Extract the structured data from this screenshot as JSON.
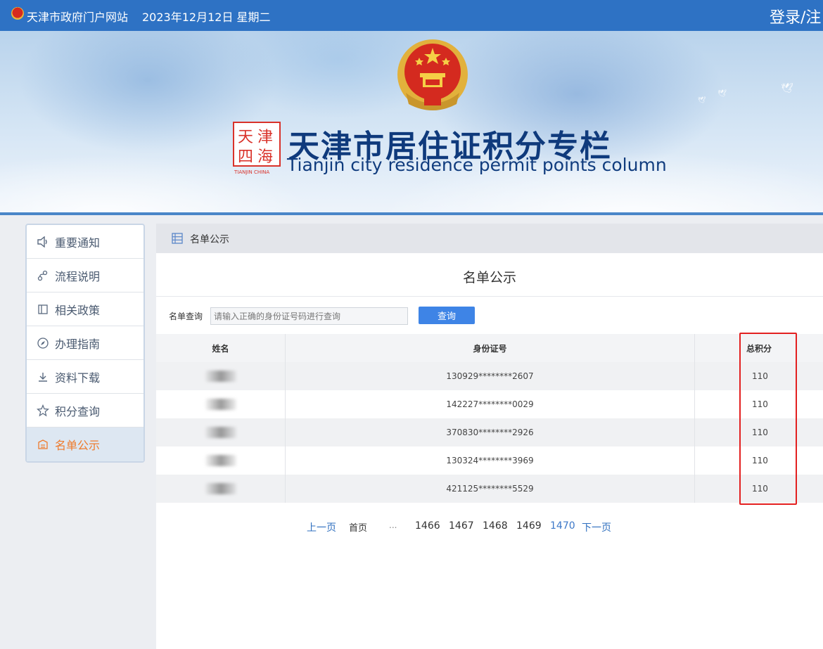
{
  "topbar": {
    "site_name": "天津市政府门户网站",
    "date_text": "2023年12月12日 星期二",
    "login_label": "登录/注"
  },
  "banner": {
    "title_cn": "天津市居住证积分专栏",
    "title_en": "Tianjin city residence permit points column"
  },
  "sidebar": {
    "items": [
      {
        "label": "重要通知",
        "icon": "speaker-icon"
      },
      {
        "label": "流程说明",
        "icon": "flow-icon"
      },
      {
        "label": "相关政策",
        "icon": "book-icon"
      },
      {
        "label": "办理指南",
        "icon": "compass-icon"
      },
      {
        "label": "资料下载",
        "icon": "download-icon"
      },
      {
        "label": "积分查询",
        "icon": "star-icon"
      },
      {
        "label": "名单公示",
        "icon": "calendar-icon"
      }
    ],
    "active_index": 6
  },
  "main": {
    "breadcrumb": "名单公示",
    "title": "名单公示",
    "search": {
      "label": "名单查询",
      "placeholder": "请输入正确的身份证号码进行查询",
      "button_label": "查询"
    },
    "table": {
      "headers": [
        "姓名",
        "身份证号",
        "总积分"
      ],
      "rows": [
        {
          "id": "130929********2607",
          "score": "110"
        },
        {
          "id": "142227********0029",
          "score": "110"
        },
        {
          "id": "370830********2926",
          "score": "110"
        },
        {
          "id": "130324********3969",
          "score": "110"
        },
        {
          "id": "421125********5529",
          "score": "110"
        }
      ]
    },
    "pagination": {
      "prev": "上一页",
      "first": "首页",
      "ellipsis": "...",
      "pages": [
        "1466",
        "1467",
        "1468",
        "1469",
        "1470"
      ],
      "current": "1470",
      "next": "下一页"
    }
  },
  "colors": {
    "topbar": "#2e72c4",
    "title_blue": "#0f3a7c",
    "active_orange": "#ee7a2c",
    "button_blue": "#3e84e6",
    "highlight_red": "#e32020"
  }
}
